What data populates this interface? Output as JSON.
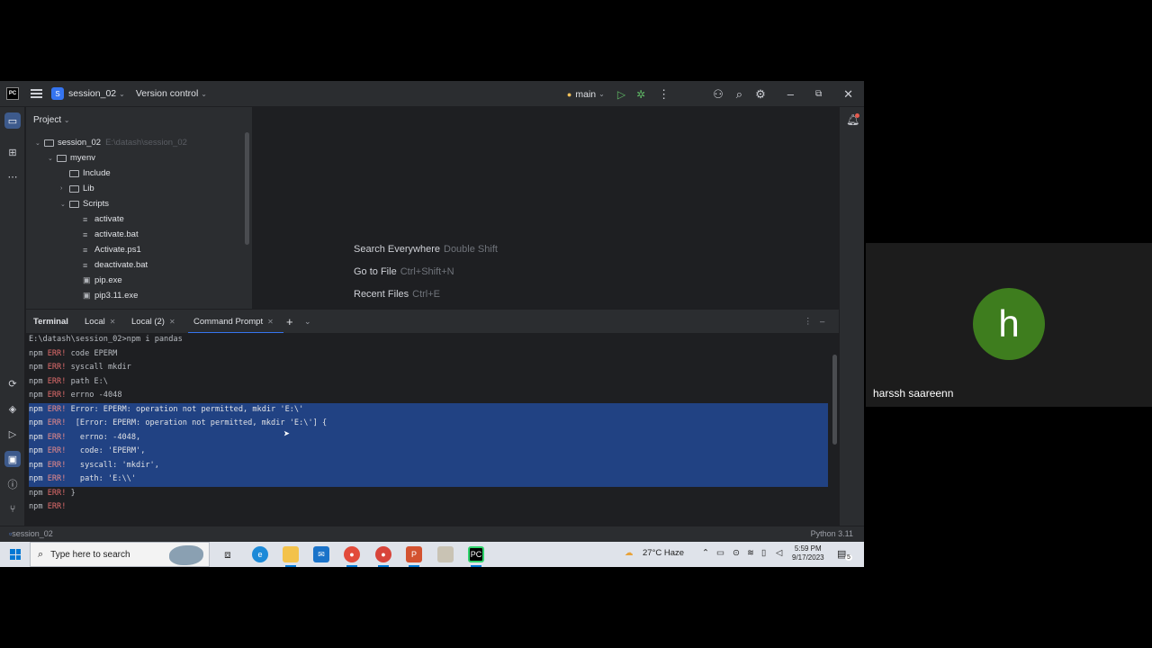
{
  "ide": {
    "project_name": "session_02",
    "project_initial": "S",
    "version_control": "Version control",
    "run_config": "main",
    "project_panel_title": "Project",
    "tree": [
      {
        "label": "session_02",
        "path": "E:\\datash\\session_02",
        "type": "folder",
        "expanded": true
      },
      {
        "label": "myenv",
        "type": "folder",
        "expanded": true
      },
      {
        "label": "Include",
        "type": "folder"
      },
      {
        "label": "Lib",
        "type": "folder",
        "expanded": false
      },
      {
        "label": "Scripts",
        "type": "folder",
        "expanded": true
      },
      {
        "label": "activate",
        "type": "file"
      },
      {
        "label": "activate.bat",
        "type": "file"
      },
      {
        "label": "Activate.ps1",
        "type": "file"
      },
      {
        "label": "deactivate.bat",
        "type": "file"
      },
      {
        "label": "pip.exe",
        "type": "file"
      },
      {
        "label": "pip3.11.exe",
        "type": "file"
      }
    ],
    "hints": [
      {
        "action": "Search Everywhere",
        "key": "Double Shift"
      },
      {
        "action": "Go to File",
        "key": "Ctrl+Shift+N"
      },
      {
        "action": "Recent Files",
        "key": "Ctrl+E"
      }
    ],
    "terminal": {
      "title": "Terminal",
      "tabs": [
        "Local",
        "Local (2)",
        "Command Prompt"
      ],
      "active_tab": "Command Prompt",
      "lines": [
        {
          "pre": "E:\\datash\\session_02>npm i pandas",
          "err": "",
          "post": ""
        },
        {
          "pre": "npm ",
          "err": "ERR!",
          "post": " code EPERM"
        },
        {
          "pre": "npm ",
          "err": "ERR!",
          "post": " syscall mkdir"
        },
        {
          "pre": "npm ",
          "err": "ERR!",
          "post": " path E:\\"
        },
        {
          "pre": "npm ",
          "err": "ERR!",
          "post": " errno -4048"
        },
        {
          "pre": "npm ",
          "err": "ERR!",
          "post": " Error: EPERM: operation not permitted, mkdir 'E:\\'"
        },
        {
          "pre": "npm ",
          "err": "ERR!",
          "post": "  [Error: EPERM: operation not permitted, mkdir 'E:\\'] {"
        },
        {
          "pre": "npm ",
          "err": "ERR!",
          "post": "   errno: -4048,"
        },
        {
          "pre": "npm ",
          "err": "ERR!",
          "post": "   code: 'EPERM',"
        },
        {
          "pre": "npm ",
          "err": "ERR!",
          "post": "   syscall: 'mkdir',"
        },
        {
          "pre": "npm ",
          "err": "ERR!",
          "post": "   path: 'E:\\\\'"
        },
        {
          "pre": "npm ",
          "err": "ERR!",
          "post": " }"
        },
        {
          "pre": "npm ",
          "err": "ERR!",
          "post": ""
        }
      ],
      "selected_lines": [
        5,
        6,
        7,
        8,
        9,
        10
      ]
    },
    "status_left": "session_02",
    "status_right": "Python 3.11"
  },
  "taskbar": {
    "search_placeholder": "Type here to search",
    "weather": "27°C  Haze",
    "time": "5:59 PM",
    "date": "9/17/2023",
    "notification_count": "5"
  },
  "participant": {
    "initial": "h",
    "name": "harssh saareenn",
    "avatar_color": "#3e7d1e"
  }
}
